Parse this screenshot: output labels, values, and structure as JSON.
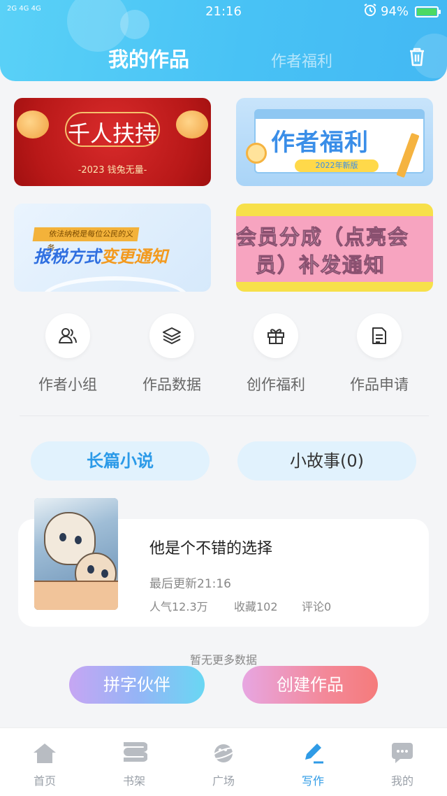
{
  "status_bar": {
    "signal": "2G 4G 4G",
    "time": "21:16",
    "battery": "94%"
  },
  "header": {
    "tab_active": "我的作品",
    "tab_inactive": "作者福利"
  },
  "banners": [
    {
      "title": "千人扶持",
      "subtitle": "-2023 钱兔无量-"
    },
    {
      "title": "作者福利",
      "tag": "2022年新版"
    },
    {
      "top_text": "依法纳税是每位公民的义务",
      "title_part1": "报税方式",
      "title_part2": "变更通知"
    },
    {
      "title_line1": "会员分成（点亮会",
      "title_line2": "员）补发通知"
    }
  ],
  "quick_entries": [
    {
      "label": "作者小组",
      "icon": "users-icon"
    },
    {
      "label": "作品数据",
      "icon": "layers-icon"
    },
    {
      "label": "创作福利",
      "icon": "gift-icon"
    },
    {
      "label": "作品申请",
      "icon": "document-icon"
    }
  ],
  "segments": {
    "long_novel": "长篇小说",
    "short_story": "小故事(0)"
  },
  "work": {
    "title": "他是个不错的选择",
    "updated": "最后更新21:16",
    "popularity": "人气12.3万",
    "favorites": "收藏102",
    "comments": "评论0"
  },
  "no_more": "暂无更多数据",
  "buttons": {
    "partner": "拼字伙伴",
    "create": "创建作品"
  },
  "nav": [
    {
      "label": "首页",
      "icon": "home-icon"
    },
    {
      "label": "书架",
      "icon": "bookshelf-icon"
    },
    {
      "label": "广场",
      "icon": "planet-icon"
    },
    {
      "label": "写作",
      "icon": "pen-icon",
      "active": true
    },
    {
      "label": "我的",
      "icon": "chat-icon"
    }
  ],
  "colors": {
    "header": "#48c2f5",
    "accent": "#2f9be6",
    "segment_bg": "#e1f2fd"
  }
}
